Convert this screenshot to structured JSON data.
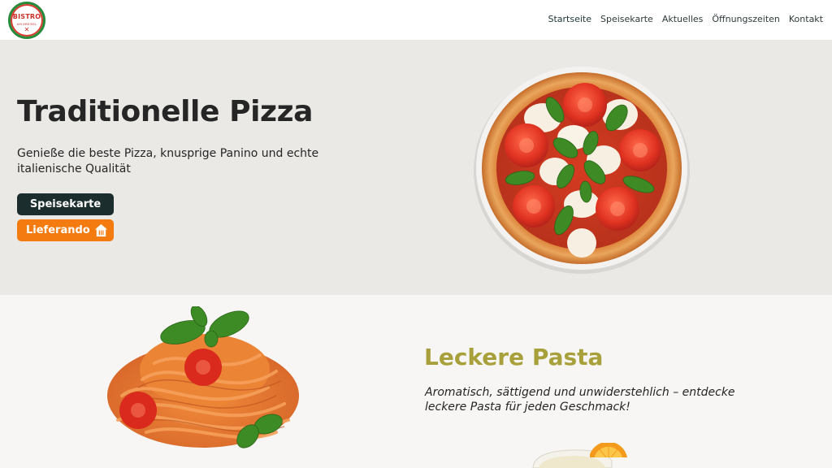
{
  "header": {
    "logo": {
      "top_text": "BISTRO",
      "mid_text": "AM KREISEL",
      "mark": "✕"
    },
    "nav": [
      {
        "label": "Startseite",
        "active": true
      },
      {
        "label": "Speisekarte",
        "active": false
      },
      {
        "label": "Aktuelles",
        "active": false
      },
      {
        "label": "Öffnungszeiten",
        "active": false
      },
      {
        "label": "Kontakt",
        "active": false
      }
    ]
  },
  "hero": {
    "title": "Traditionelle Pizza",
    "text": "Genieße die beste Pizza, knusprige Panino und echte italienische Qualität",
    "buttons": {
      "menu": "Speisekarte",
      "delivery": "Lieferando"
    },
    "image": "pizza-margherita-image"
  },
  "pasta": {
    "title": "Leckere Pasta",
    "text": "Aromatisch, sättigend und unwiderstehlich – entdecke leckere Pasta für jeden Geschmack!",
    "image": "pasta-image"
  },
  "colors": {
    "hero_bg": "#ebe9e6",
    "section_bg": "#f7f6f4",
    "dark_button": "#1b2d2c",
    "orange_button": "#f47b10",
    "pasta_title": "#a8a13b"
  }
}
